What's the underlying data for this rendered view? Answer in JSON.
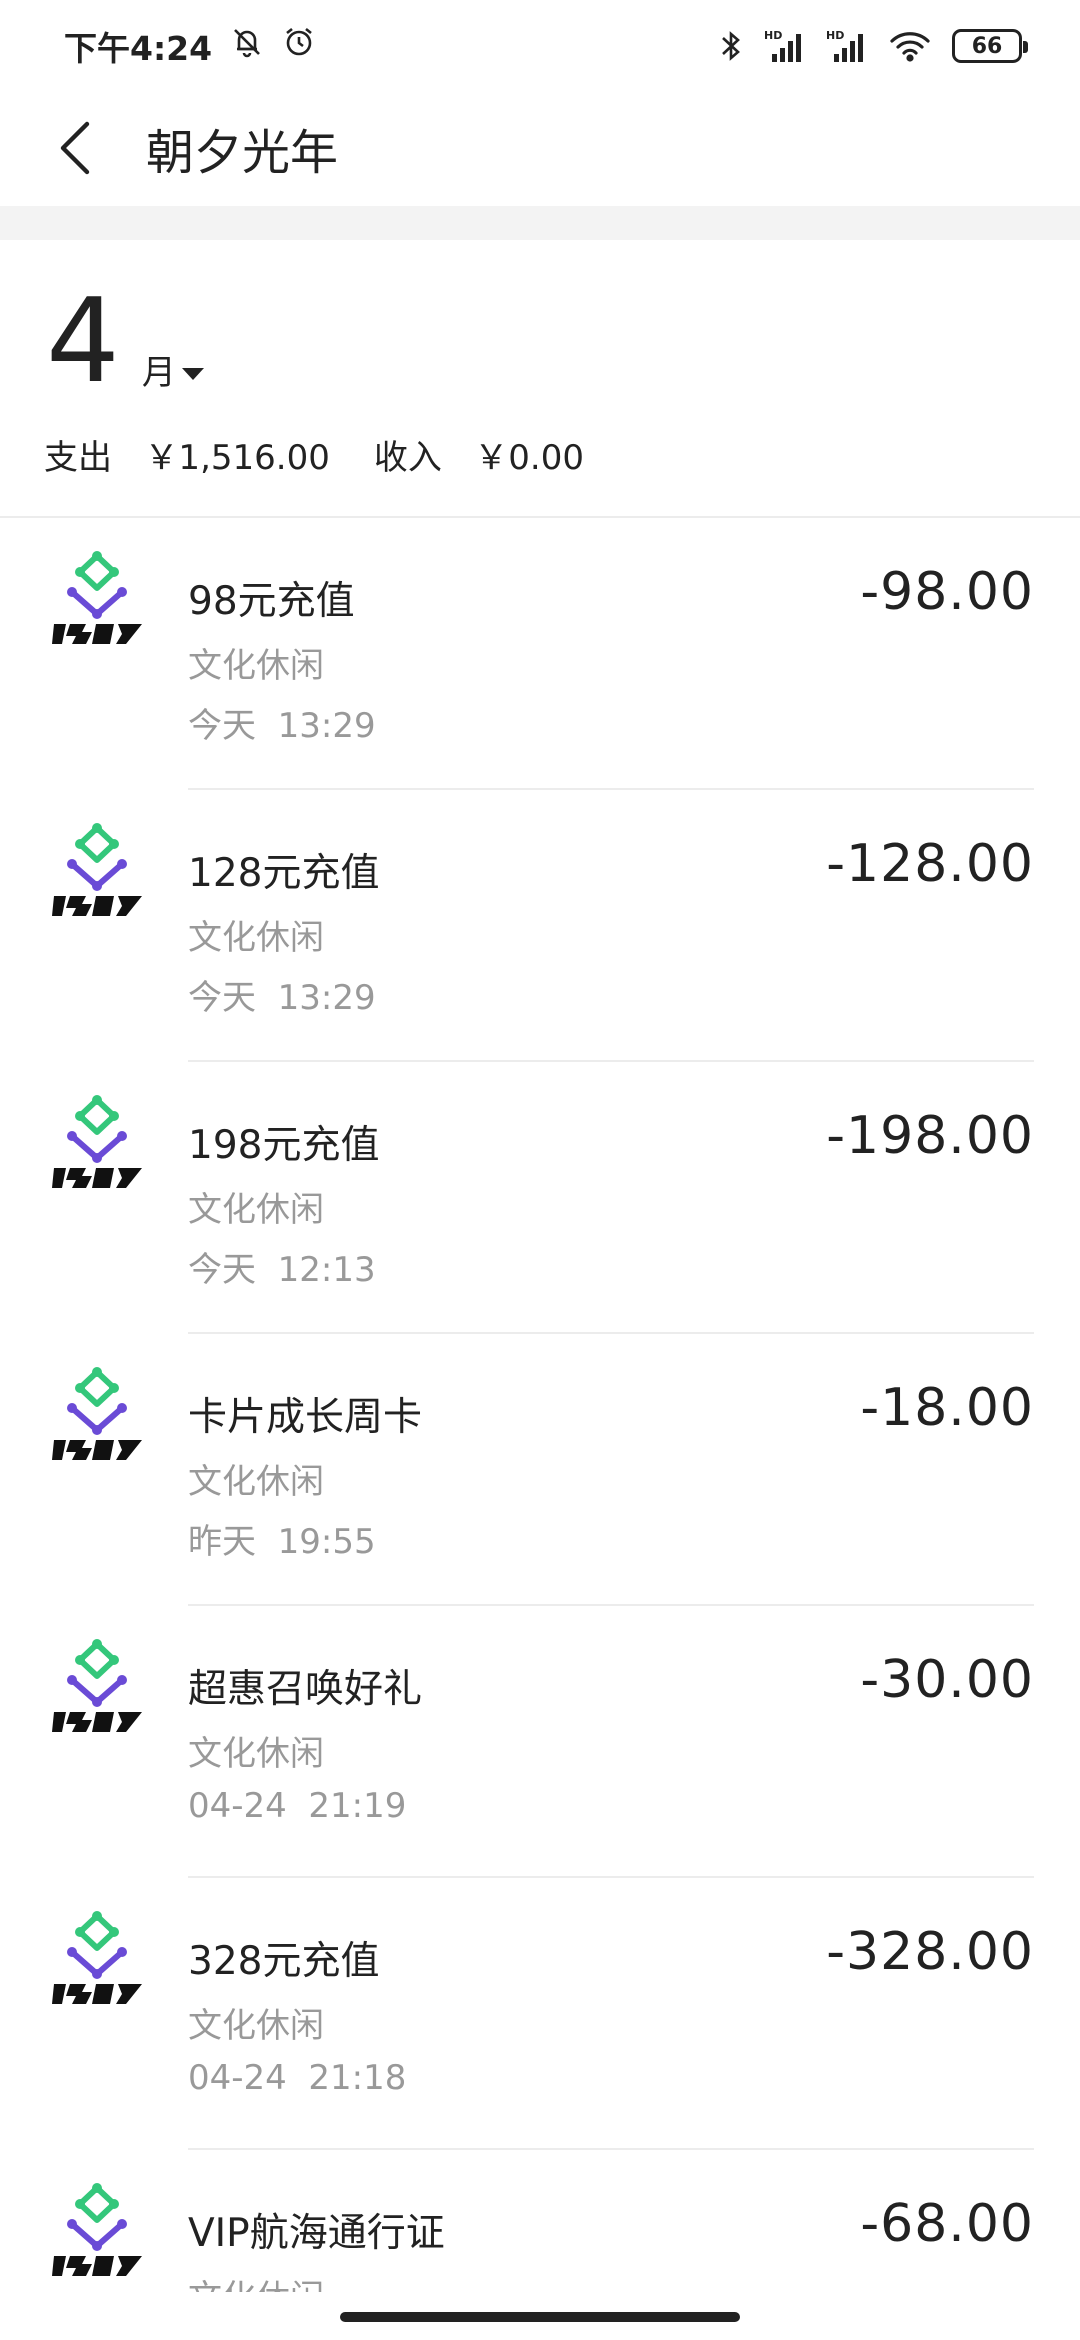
{
  "status_bar": {
    "time": "下午4:24",
    "battery": "66"
  },
  "header": {
    "title": "朝夕光年"
  },
  "summary": {
    "month_number": "4",
    "month_unit": "月",
    "expense_label": "支出",
    "expense_value": "￥1,516.00",
    "income_label": "收入",
    "income_value": "￥0.00"
  },
  "transactions": [
    {
      "title": "98元充值",
      "category": "文化休闲",
      "date": "今天",
      "time": "13:29",
      "amount": "-98.00"
    },
    {
      "title": "128元充值",
      "category": "文化休闲",
      "date": "今天",
      "time": "13:29",
      "amount": "-128.00"
    },
    {
      "title": "198元充值",
      "category": "文化休闲",
      "date": "今天",
      "time": "12:13",
      "amount": "-198.00"
    },
    {
      "title": "卡片成长周卡",
      "category": "文化休闲",
      "date": "昨天",
      "time": "19:55",
      "amount": "-18.00"
    },
    {
      "title": "超惠召唤好礼",
      "category": "文化休闲",
      "date": "04-24",
      "time": "21:19",
      "amount": "-30.00"
    },
    {
      "title": "328元充值",
      "category": "文化休闲",
      "date": "04-24",
      "time": "21:18",
      "amount": "-328.00"
    },
    {
      "title": "VIP航海通行证",
      "category": "文化休闲",
      "date": "",
      "time": "",
      "amount": "-68.00"
    }
  ],
  "colors": {
    "logo_green": "#34c77b",
    "logo_purple": "#6a4bd6",
    "secondary_text": "#999999"
  }
}
